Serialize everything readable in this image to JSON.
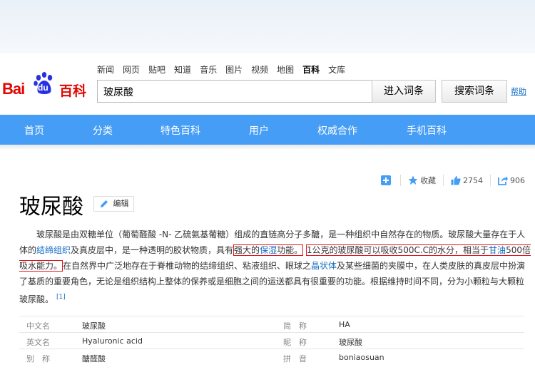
{
  "header": {
    "logo": {
      "bai": "Bai",
      "du": "du",
      "baike": "百科"
    },
    "top_nav": [
      "新闻",
      "网页",
      "贴吧",
      "知道",
      "音乐",
      "图片",
      "视频",
      "地图",
      "百科",
      "文库"
    ],
    "top_nav_current": "百科",
    "search_value": "玻尿酸",
    "enter_button": "进入词条",
    "search_button": "搜索词条",
    "help_link": "帮助"
  },
  "main_nav": [
    "首页",
    "分类",
    "特色百科",
    "用户",
    "权威合作",
    "手机百科"
  ],
  "tools": {
    "collect": "收藏",
    "likes": "2754",
    "shares": "906"
  },
  "article": {
    "title": "玻尿酸",
    "edit_label": "编辑",
    "summary_parts": {
      "s1": "玻尿酸是由双糖单位（葡萄醛酸 -N- 乙硫氨基葡糖）组成的直链高分子多醣，是一种组织中自然存在的物质。玻尿酸大量存在于人体的",
      "link1": "结缔组织",
      "s2": "及真皮层中，是一种透明的胶状物质，具有",
      "hl1_pre": "强大的",
      "link2": "保湿",
      "hl1_post": "功能。",
      "hl2_pre": "1公克的玻尿酸可以吸收500C.C的水分，相当于",
      "link3": "甘油",
      "hl2_post": "500倍吸水能力。",
      "s3": "在自然界中广泛地存在于脊椎动物的结缔组织、粘液组织、眼球之",
      "link4": "晶状体",
      "s4": "及某些细菌的夹膜中，在人类皮肤的真皮层中扮演了基质的重要角色，无论是组织结构上整体的保养或是细胞之间的运送都具有很重要的功能。根据维持时间不同，分为小颗粒与大颗粒玻尿酸。",
      "ref": "[1]"
    }
  },
  "basic_info": [
    {
      "k1": "中文名",
      "v1": "玻尿酸",
      "k2": "简　称",
      "v2": "HA"
    },
    {
      "k1": "英文名",
      "v1": "Hyaluronic acid",
      "k2": "昵　称",
      "v2": "玻尿酸"
    },
    {
      "k1": "别　称",
      "v1": "醣醛酸",
      "k2": "拼　音",
      "v2": "boniaosuan"
    }
  ],
  "colors": {
    "brand_red": "#e10601",
    "nav_blue": "#459df5",
    "link_blue": "#136ec2",
    "highlight_red": "#e3151c"
  }
}
